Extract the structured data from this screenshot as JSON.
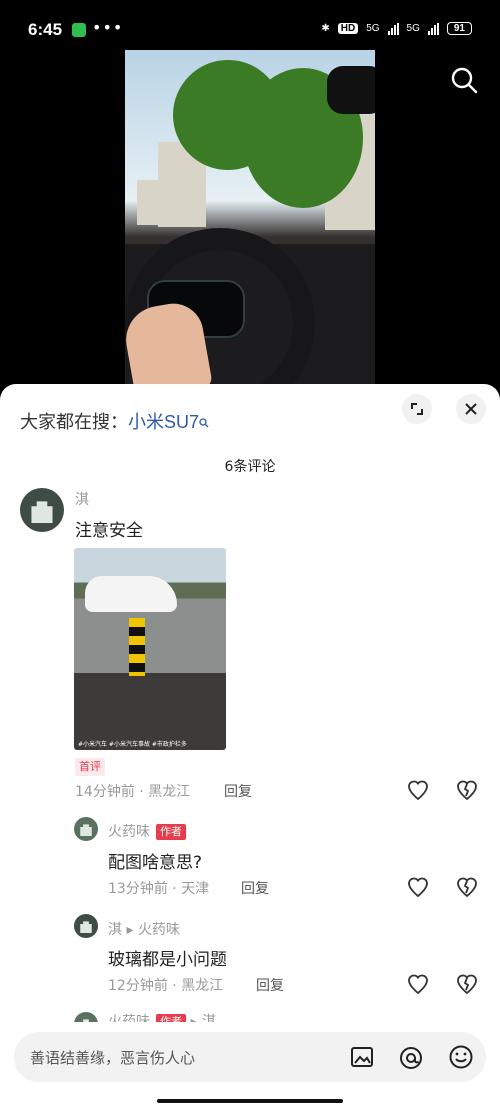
{
  "status": {
    "time": "6:45",
    "network_hd": "HD",
    "network_5g_1": "5G",
    "network_5g_2": "5G",
    "battery": "91"
  },
  "trending": {
    "prefix": "大家都在搜：",
    "term": "小米SU7"
  },
  "comment_count": "6条评论",
  "comments": [
    {
      "user": "淇",
      "text": "注意安全",
      "badge": "首评",
      "time": "14分钟前",
      "location": "黑龙江",
      "reply": "回复",
      "image_caption": "#小米汽车 #小米汽车事故 #市政护栏多"
    },
    {
      "user": "火药味",
      "author_tag": "作者",
      "text": "配图啥意思?",
      "time": "13分钟前",
      "location": "天津",
      "reply": "回复"
    },
    {
      "user": "淇",
      "reply_to": "火药味",
      "text": "玻璃都是小问题",
      "time": "12分钟前",
      "location": "黑龙江",
      "reply": "回复"
    },
    {
      "user": "火药味",
      "author_tag": "作者",
      "reply_to": "淇"
    }
  ],
  "input": {
    "placeholder": "善语结善缘，恶言伤人心"
  }
}
